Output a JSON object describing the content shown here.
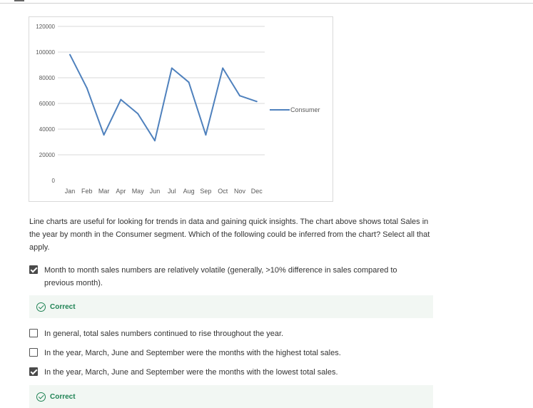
{
  "question": {
    "text": "Line charts are useful for looking for trends in data and gaining quick insights.  The chart above shows total Sales in the year by month in the Consumer segment.  Which of the following could be inferred from the chart?  Select all that apply."
  },
  "options": [
    {
      "label": "Month to month sales numbers are relatively volatile (generally, >10% difference in sales compared to previous month).",
      "checked": true
    },
    {
      "label": "In general, total sales numbers continued to rise throughout the year.",
      "checked": false
    },
    {
      "label": "In the year, March, June and September were the months with the highest total sales.",
      "checked": false
    },
    {
      "label": "In the year, March, June and September were the months with the lowest total sales.",
      "checked": true
    }
  ],
  "feedback": [
    {
      "label": "Correct"
    },
    {
      "label": "Correct"
    }
  ],
  "colors": {
    "series": "#4f81bd",
    "correct": "#1f8354",
    "feedback_bg": "#f2f7f3"
  },
  "icons": [
    "checkbox-checked-icon",
    "checkbox-empty-icon",
    "check-circle-icon"
  ],
  "chart_data": {
    "type": "line",
    "categories": [
      "Jan",
      "Feb",
      "Mar",
      "Apr",
      "May",
      "Jun",
      "Jul",
      "Aug",
      "Sep",
      "Oct",
      "Nov",
      "Dec"
    ],
    "series": [
      {
        "name": "Consumer",
        "values": [
          98000,
          72000,
          35500,
          63000,
          52000,
          31000,
          87500,
          76500,
          35500,
          87500,
          66000,
          61500
        ]
      }
    ],
    "yticks": [
      "0",
      "20000",
      "40000",
      "60000",
      "80000",
      "100000",
      "120000"
    ],
    "ylim": [
      0,
      120000
    ],
    "grid": true,
    "legend": "right"
  }
}
